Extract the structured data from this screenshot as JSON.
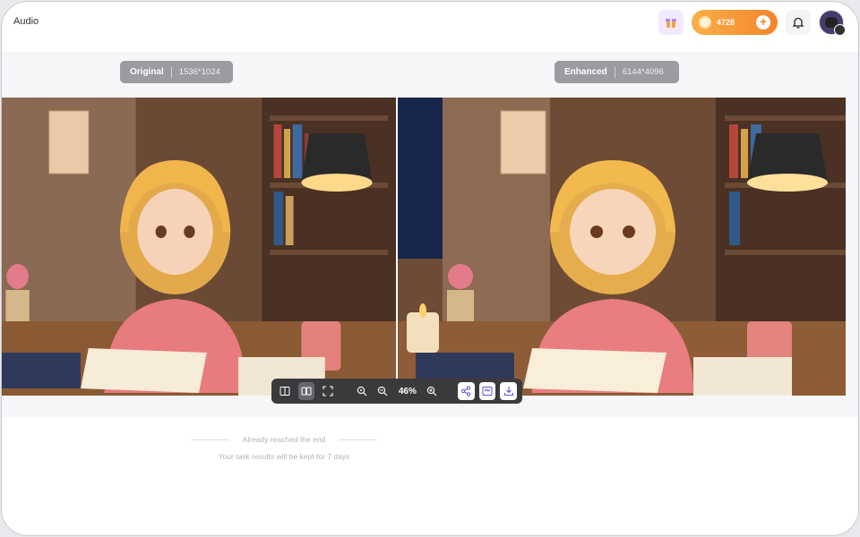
{
  "app": {
    "title": "Audio"
  },
  "header": {
    "credits": "4728",
    "gift_icon": "gift-icon",
    "bell_icon": "bell-icon",
    "plus_icon": "plus-icon"
  },
  "compare": {
    "original": {
      "label": "Original",
      "resolution": "1536*1024"
    },
    "enhanced": {
      "label": "Enhanced",
      "resolution": "6144*4096"
    }
  },
  "toolbar": {
    "zoom": "46%",
    "icons": [
      "split-view-icon",
      "side-by-side-icon",
      "fullscreen-icon",
      "zoom-fit-icon",
      "zoom-out-icon",
      "zoom-in-icon",
      "share-icon",
      "compare-icon",
      "download-icon"
    ]
  },
  "footer": {
    "end_text": "Already reached the end",
    "keep_text": "Your task results will be kept for 7 days"
  },
  "colors": {
    "credits_gradient_start": "#f7b04a",
    "credits_gradient_end": "#f5832b",
    "label_pill": "#9b9ba0",
    "toolbar": "#3a3a3d"
  }
}
